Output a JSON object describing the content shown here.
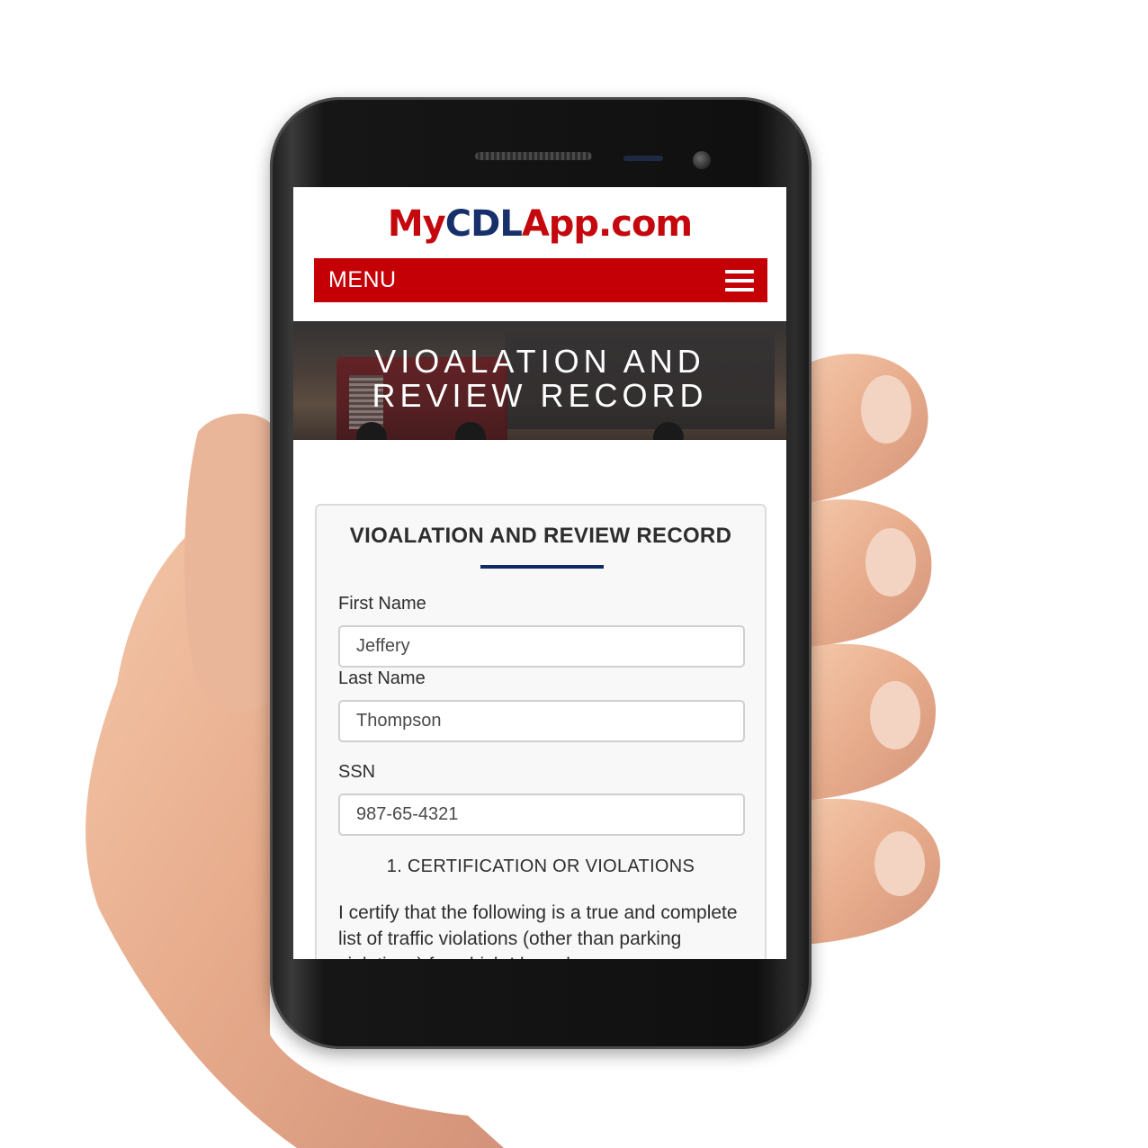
{
  "site": {
    "logo_part1": "My",
    "logo_part2": "CDL",
    "logo_part3": "App.com",
    "brand_red": "#c40006",
    "brand_blue": "#17306b"
  },
  "nav": {
    "menu_label": "MENU",
    "menu_icon": "hamburger-icon"
  },
  "hero": {
    "title_line1": "VIOALATION AND",
    "title_line2": "REVIEW RECORD"
  },
  "form": {
    "title": "VIOALATION AND REVIEW RECORD",
    "first_name_label": "First Name",
    "first_name_value": "Jeffery",
    "last_name_label": "Last Name",
    "last_name_value": "Thompson",
    "ssn_label": "SSN",
    "ssn_value": "987-65-4321",
    "section_heading": "1. CERTIFICATION OR VIOLATIONS",
    "certification_text": "I certify that the following is a true and complete list of traffic violations (other than parking violations) for which I have been"
  }
}
